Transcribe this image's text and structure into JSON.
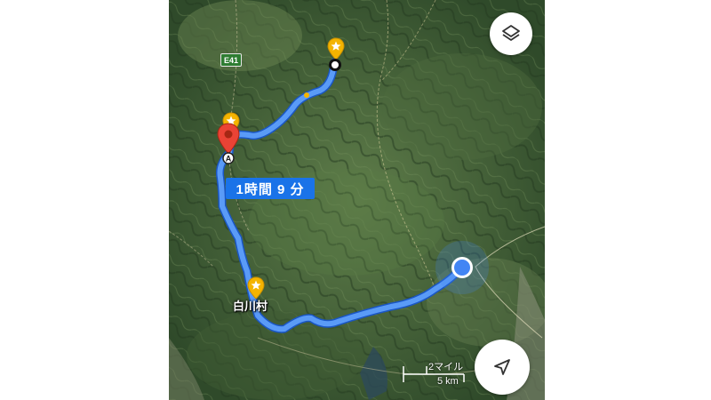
{
  "map": {
    "travel_time": "1時間 9 分",
    "route_number": "E41",
    "place_name": "白川村",
    "marker_letter": "A",
    "scale": {
      "miles": "2マイル",
      "km": "5 km"
    },
    "route_color": "#4285f4",
    "marker_color": "#ea4335",
    "star_color": "#f4b400"
  },
  "controls": {
    "layers_icon": "layers-icon",
    "navigate_icon": "navigation-arrow-icon"
  }
}
